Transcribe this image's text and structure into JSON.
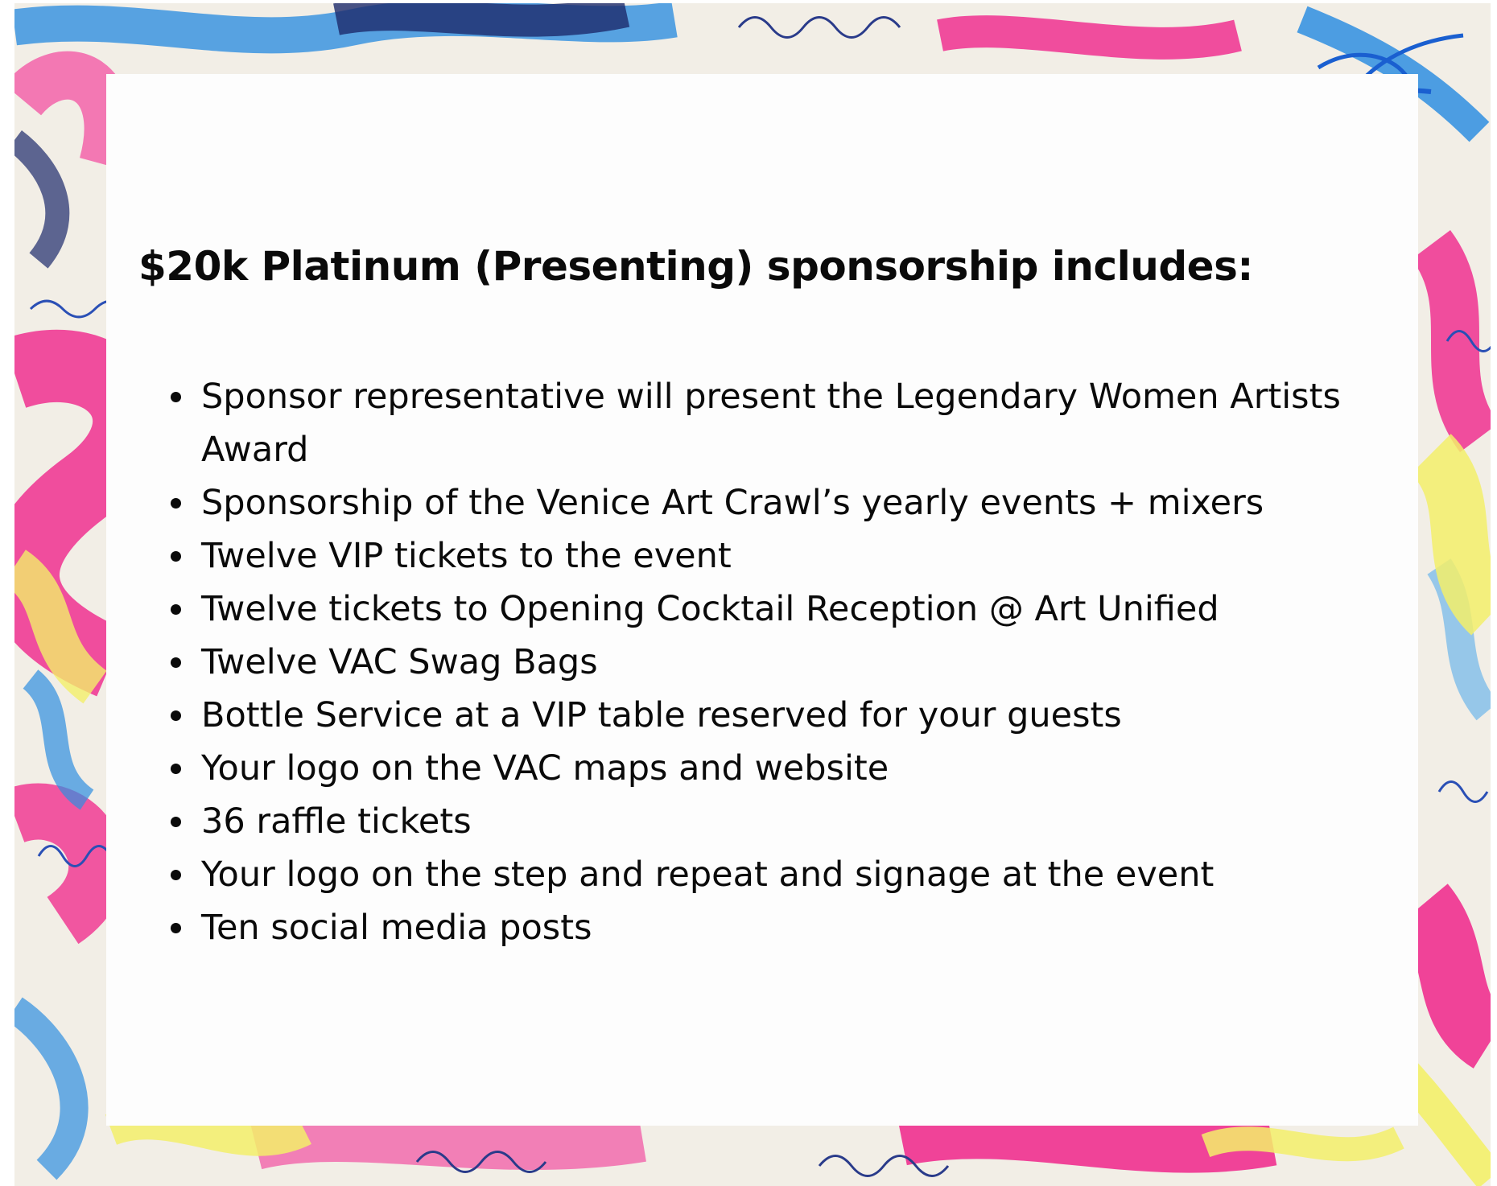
{
  "heading": "$20k Platinum (Presenting) sponsorship includes:",
  "benefits": [
    "Sponsor representative will present the Legendary Women Artists Award",
    "Sponsorship of the Venice Art Crawl’s yearly events + mixers",
    "Twelve VIP tickets to the event",
    "Twelve tickets to Opening Cocktail Reception @ Art Unified",
    "Twelve VAC Swag Bags",
    "Bottle Service at a VIP table reserved for your guests",
    "Your logo on the VAC maps and website",
    "36 raffle tickets",
    "Your logo on the step and repeat and signage at the event",
    "Ten social media posts"
  ],
  "colors": {
    "card": "#fdfdfd",
    "text": "#0a0a0a",
    "paint_pink": "#f0308f",
    "paint_blue": "#2f8ee0",
    "paint_yellow": "#f3ef6a",
    "paint_navy": "#1d2a6b",
    "paper": "#f2eee6"
  },
  "background": {
    "description_icon": "painted-scribble-frame"
  }
}
